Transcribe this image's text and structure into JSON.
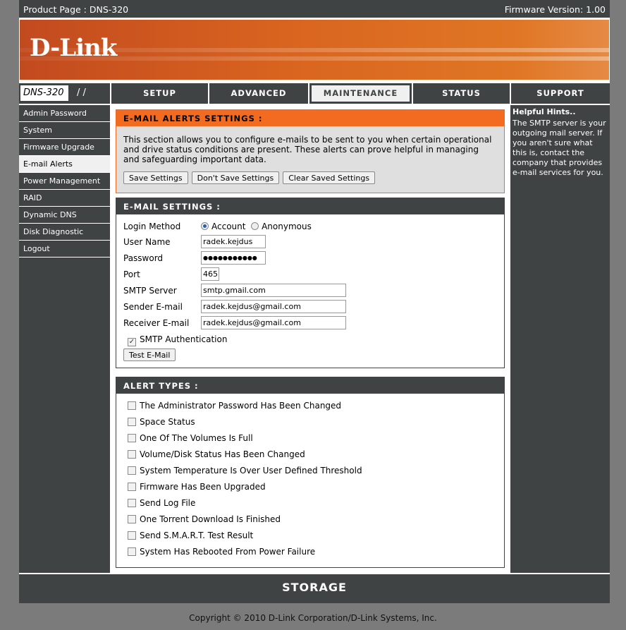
{
  "topbar": {
    "product": "Product Page : DNS-320",
    "firmware": "Firmware Version: 1.00"
  },
  "logo": "D-Link",
  "nav": {
    "model": "DNS-320",
    "tabs": [
      "SETUP",
      "ADVANCED",
      "MAINTENANCE",
      "STATUS",
      "SUPPORT"
    ],
    "active": "MAINTENANCE"
  },
  "sidebar": {
    "items": [
      "Admin Password",
      "System",
      "Firmware Upgrade",
      "E-mail Alerts",
      "Power Management",
      "RAID",
      "Dynamic DNS",
      "Disk Diagnostic",
      "Logout"
    ],
    "selected": "E-mail Alerts"
  },
  "alerts_settings": {
    "title": "E-MAIL ALERTS SETTINGS :",
    "description": "This section allows you to configure e-mails to be sent to you when certain operational and drive status conditions are present. These alerts can prove helpful in managing and safeguarding important data.",
    "save": "Save Settings",
    "dont_save": "Don't Save Settings",
    "clear": "Clear Saved Settings"
  },
  "email_settings": {
    "title": "E-MAIL SETTINGS :",
    "login_method_label": "Login Method",
    "account": "Account",
    "anonymous": "Anonymous",
    "login_method": "Account",
    "username_label": "User Name",
    "username": "radek.kejdus",
    "password_label": "Password",
    "password": "●●●●●●●●●●●",
    "port_label": "Port",
    "port": "465",
    "smtp_label": "SMTP Server",
    "smtp": "smtp.gmail.com",
    "sender_label": "Sender E-mail",
    "sender": "radek.kejdus@gmail.com",
    "receiver_label": "Receiver E-mail",
    "receiver": "radek.kejdus@gmail.com",
    "smtp_auth_label": "SMTP Authentication",
    "smtp_auth": true,
    "test": "Test E-Mail"
  },
  "alert_types": {
    "title": "ALERT TYPES :",
    "items": [
      "The Administrator Password Has Been Changed",
      "Space Status",
      "One Of The Volumes Is Full",
      "Volume/Disk Status Has Been Changed",
      "System Temperature Is Over User Defined Threshold",
      "Firmware Has Been Upgraded",
      "Send Log File",
      "One Torrent Download Is Finished",
      "Send S.M.A.R.T. Test Result",
      "System Has Rebooted From Power Failure"
    ]
  },
  "hints": {
    "title": "Helpful Hints..",
    "text": "The SMTP server is your outgoing mail server. If you aren't sure what this is, contact the company that provides e-mail services for you."
  },
  "footer": {
    "storage": "STORAGE",
    "copyright": "Copyright © 2010 D-Link Corporation/D-Link Systems, Inc."
  },
  "colors": {
    "accent": "#f26b21",
    "dark": "#404344"
  }
}
